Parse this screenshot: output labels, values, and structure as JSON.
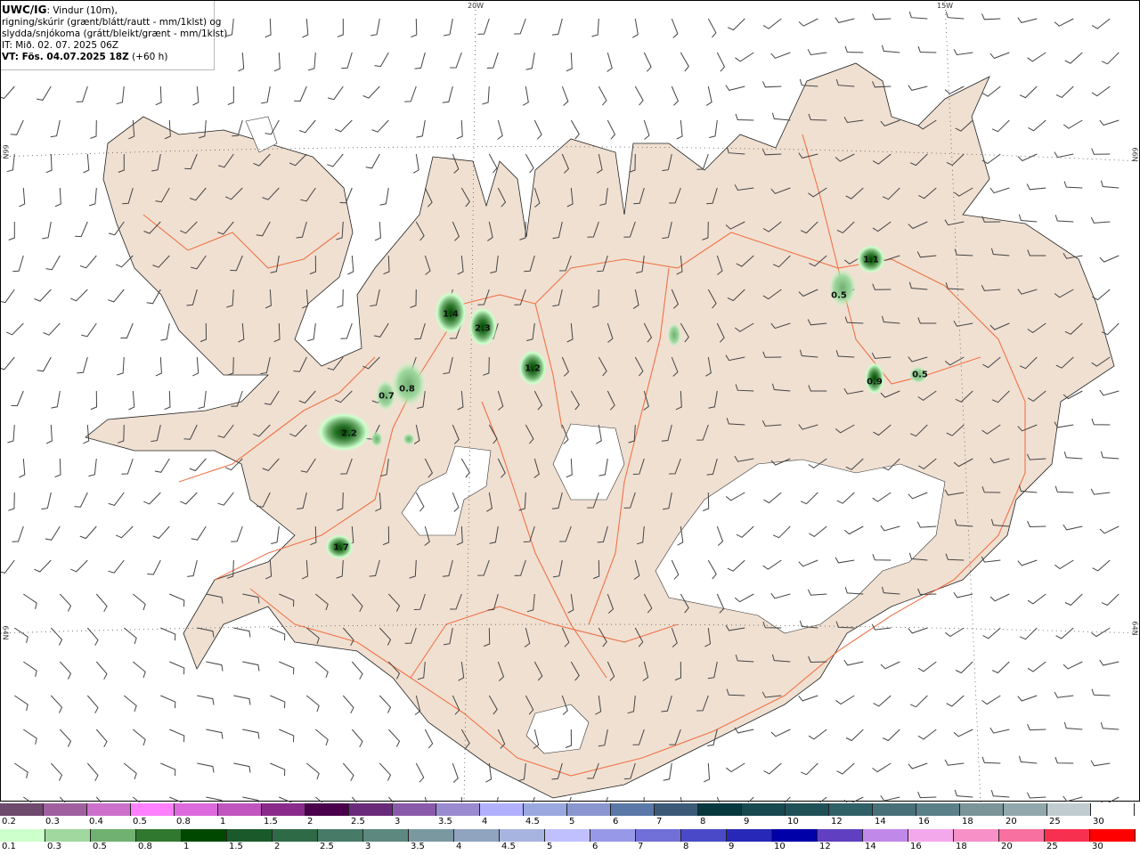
{
  "header": {
    "product": "UWC/IG",
    "desc1": ": Vindur (10m),",
    "desc2": "rigning/skúrir (grænt/blátt/rautt - mm/1klst) og",
    "desc3": "slydda/snjókoma (grátt/bleikt/grænt - mm/1klst)",
    "issue_time": "IT: Mið. 02. 07. 2025 06Z",
    "valid_time": "VT: Fös. 04.07.2025 18Z",
    "lead": " (+60 h)"
  },
  "grid_labels": {
    "lon_20w": "20W",
    "lon_15w": "15W",
    "lat_66n_left": "66N",
    "lat_64n_left": "64N",
    "lat_66n_right": "66N",
    "lat_64n_right": "64N"
  },
  "colors": {
    "land": "#f0e0d2",
    "sea": "#ffffff",
    "roads": "#f06030",
    "glacier": "#ffffff",
    "wind_barbs": "#444444"
  },
  "precip_labels": [
    "1.4",
    "2.3",
    "1.2",
    "0.7",
    "0.8",
    "2.2",
    "1.7",
    "1.1",
    "0.5",
    "0.9",
    "0.5"
  ],
  "legend_snow": {
    "labels": [
      "0.2",
      "0.3",
      "0.4",
      "0.5",
      "0.8",
      "1",
      "1.5",
      "2",
      "2.5",
      "3",
      "3.5",
      "4",
      "4.5",
      "5",
      "6",
      "7",
      "8",
      "9",
      "10",
      "12",
      "14",
      "16",
      "18",
      "20",
      "25",
      "30"
    ],
    "colors": [
      "#6e4a6e",
      "#a060a0",
      "#cc70cc",
      "#ff80ff",
      "#dc6adc",
      "#c055c0",
      "#8a2a8a",
      "#4a004a",
      "#6a2a7a",
      "#8a5aaa",
      "#9a8ad0",
      "#b0b0ff",
      "#9aa8e0",
      "#8a96d0",
      "#5a78a8",
      "#3a5a78",
      "#08383f",
      "#184850",
      "#205058",
      "#306068",
      "#487078",
      "#5a8088",
      "#7a9498",
      "#90a8ac",
      "#c0ccd0",
      "#ffffff"
    ]
  },
  "legend_rain": {
    "labels": [
      "0.1",
      "0.3",
      "0.5",
      "0.8",
      "1",
      "1.5",
      "2",
      "2.5",
      "3",
      "3.5",
      "4",
      "4.5",
      "5",
      "6",
      "7",
      "8",
      "9",
      "10",
      "12",
      "14",
      "16",
      "18",
      "20",
      "25",
      "30"
    ],
    "colors": [
      "#ccffcc",
      "#a0d8a0",
      "#70b070",
      "#307830",
      "#004800",
      "#1a5a2a",
      "#2e6a46",
      "#487a68",
      "#5c8880",
      "#7a98a0",
      "#90a4c0",
      "#a8b4e0",
      "#c0c0ff",
      "#9898e8",
      "#7070d8",
      "#4a4ac8",
      "#2828b8",
      "#0000a8",
      "#6040c0",
      "#c088e8",
      "#f4a8ec",
      "#f890c8",
      "#f870a0",
      "#f83050",
      "#ff0000"
    ]
  }
}
